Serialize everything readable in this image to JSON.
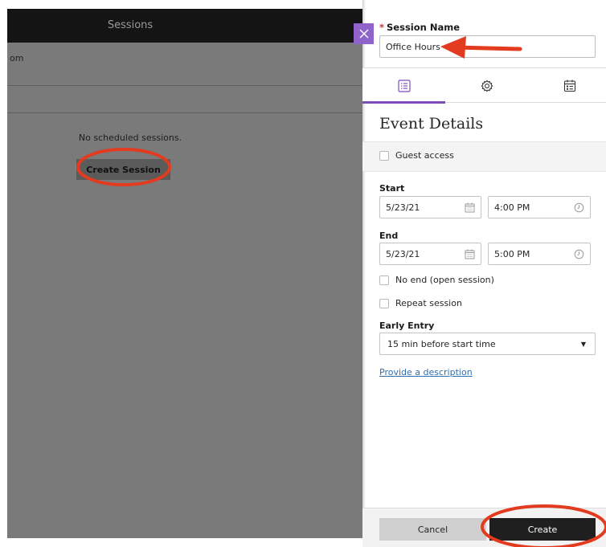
{
  "sessions_panel": {
    "header_title": "Sessions",
    "room_label": "om",
    "empty_message": "No scheduled sessions.",
    "create_session_label": "Create Session"
  },
  "drawer": {
    "session_name": {
      "required_marker": "*",
      "label": "Session Name",
      "value": "Office Hours"
    },
    "tabs": [
      {
        "icon": "event-details-icon",
        "active": true
      },
      {
        "icon": "settings-gear-icon",
        "active": false
      },
      {
        "icon": "content-sharing-icon",
        "active": false
      }
    ],
    "section_title": "Event Details",
    "guest_access_label": "Guest access",
    "start": {
      "label": "Start",
      "date": "5/23/21",
      "time": "4:00 PM"
    },
    "end": {
      "label": "End",
      "date": "5/23/21",
      "time": "5:00 PM"
    },
    "no_end_label": "No end (open session)",
    "repeat_label": "Repeat session",
    "early_entry": {
      "label": "Early Entry",
      "selected": "15 min before start time"
    },
    "description_link": "Provide a description",
    "footer": {
      "cancel_label": "Cancel",
      "create_label": "Create"
    }
  },
  "colors": {
    "accent_purple": "#7c4cb8",
    "annotation_red": "#e23b1f",
    "overlay_gray": "#7a7a7a",
    "link_blue": "#2e6fb2"
  }
}
